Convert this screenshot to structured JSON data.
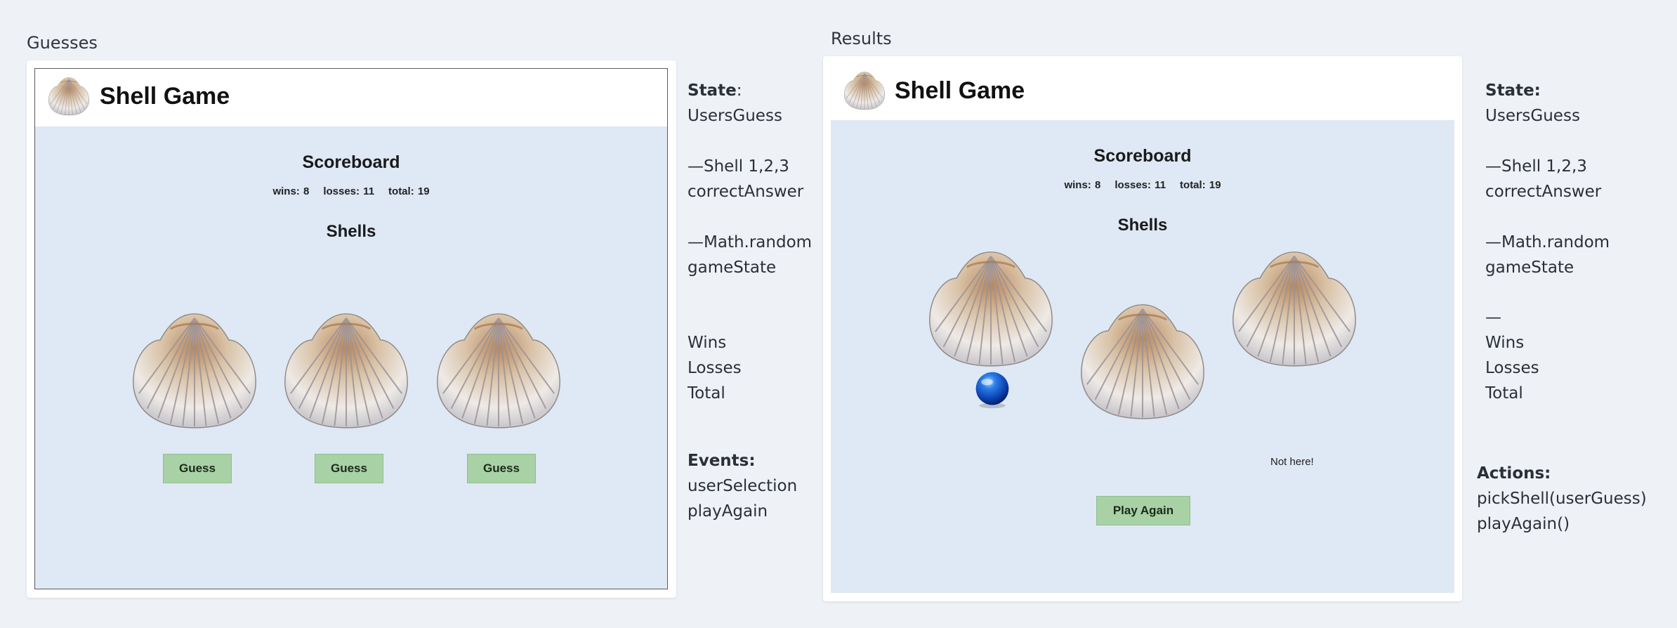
{
  "left": {
    "frame_title": "Guesses",
    "app_title": "Shell Game",
    "scoreboard_title": "Scoreboard",
    "wins": "wins: 8",
    "losses": "losses: 11",
    "total": "total: 19",
    "shells_title": "Shells",
    "guess_buttons": [
      "Guess",
      "Guess",
      "Guess"
    ],
    "notes": {
      "state_label": "State",
      "state_suffix": ":",
      "state_value": "UsersGuess",
      "shell_line": "—Shell 1,2,3",
      "correct_answer": "correctAnswer",
      "math_line": "—Math.random",
      "game_state": "gameState",
      "wins": "Wins",
      "losses": "Losses",
      "total": "Total",
      "events_label": "Events:",
      "event_1": "userSelection",
      "event_2": "playAgain"
    }
  },
  "right": {
    "frame_title": "Results",
    "app_title": "Shell Game",
    "scoreboard_title": "Scoreboard",
    "wins": "wins: 8",
    "losses": "losses: 11",
    "total": "total: 19",
    "shells_title": "Shells",
    "not_here": "Not here!",
    "play_again": "Play Again",
    "notes": {
      "state_label": "State:",
      "state_value": "UsersGuess",
      "shell_line": "—Shell 1,2,3",
      "correct_answer": "correctAnswer",
      "math_line": "—Math.random",
      "game_state": "gameState",
      "dash": "—",
      "wins": "Wins",
      "losses": "Losses",
      "total": "Total",
      "actions_label": "Actions:",
      "action_1": "pickShell(userGuess)",
      "action_2": "playAgain()"
    }
  },
  "colors": {
    "page_bg": "#eef2f6",
    "app_body_bg": "#dfe8f5",
    "button_green": "#a8d1a6",
    "ball_blue": "#1a5fd6"
  },
  "icons": {
    "shell": "seashell-image",
    "ball": "blue-ball"
  }
}
